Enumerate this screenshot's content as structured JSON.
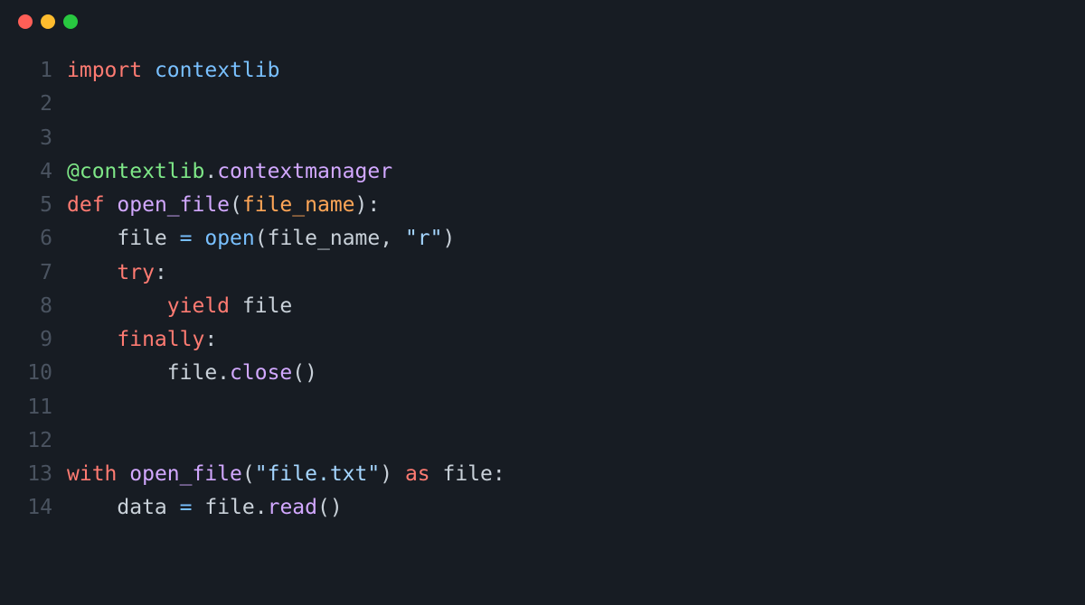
{
  "window": {
    "dots": [
      "red",
      "yellow",
      "green"
    ]
  },
  "code": {
    "lines": [
      {
        "num": "1",
        "tokens": [
          {
            "t": "import",
            "c": "kw"
          },
          {
            "t": " ",
            "c": ""
          },
          {
            "t": "contextlib",
            "c": "ident"
          }
        ]
      },
      {
        "num": "2",
        "tokens": []
      },
      {
        "num": "3",
        "tokens": []
      },
      {
        "num": "4",
        "tokens": [
          {
            "t": "@contextlib",
            "c": "dec"
          },
          {
            "t": ".",
            "c": "punct"
          },
          {
            "t": "contextmanager",
            "c": "decfn"
          }
        ]
      },
      {
        "num": "5",
        "tokens": [
          {
            "t": "def",
            "c": "kw"
          },
          {
            "t": " ",
            "c": ""
          },
          {
            "t": "open_file",
            "c": "fn"
          },
          {
            "t": "(",
            "c": "punct"
          },
          {
            "t": "file_name",
            "c": "param"
          },
          {
            "t": "):",
            "c": "punct"
          }
        ]
      },
      {
        "num": "6",
        "tokens": [
          {
            "t": "    ",
            "c": ""
          },
          {
            "t": "file",
            "c": "var"
          },
          {
            "t": " ",
            "c": ""
          },
          {
            "t": "=",
            "c": "op"
          },
          {
            "t": " ",
            "c": ""
          },
          {
            "t": "open",
            "c": "builtin"
          },
          {
            "t": "(",
            "c": "punct"
          },
          {
            "t": "file_name",
            "c": "var"
          },
          {
            "t": ", ",
            "c": "punct"
          },
          {
            "t": "\"r\"",
            "c": "str"
          },
          {
            "t": ")",
            "c": "punct"
          }
        ]
      },
      {
        "num": "7",
        "tokens": [
          {
            "t": "    ",
            "c": ""
          },
          {
            "t": "try",
            "c": "kw"
          },
          {
            "t": ":",
            "c": "punct"
          }
        ]
      },
      {
        "num": "8",
        "tokens": [
          {
            "t": "        ",
            "c": ""
          },
          {
            "t": "yield",
            "c": "kw"
          },
          {
            "t": " ",
            "c": ""
          },
          {
            "t": "file",
            "c": "var"
          }
        ]
      },
      {
        "num": "9",
        "tokens": [
          {
            "t": "    ",
            "c": ""
          },
          {
            "t": "finally",
            "c": "kw"
          },
          {
            "t": ":",
            "c": "punct"
          }
        ]
      },
      {
        "num": "10",
        "tokens": [
          {
            "t": "        ",
            "c": ""
          },
          {
            "t": "file",
            "c": "var"
          },
          {
            "t": ".",
            "c": "punct"
          },
          {
            "t": "close",
            "c": "fn"
          },
          {
            "t": "()",
            "c": "punct"
          }
        ]
      },
      {
        "num": "11",
        "tokens": []
      },
      {
        "num": "12",
        "tokens": []
      },
      {
        "num": "13",
        "tokens": [
          {
            "t": "with",
            "c": "kw"
          },
          {
            "t": " ",
            "c": ""
          },
          {
            "t": "open_file",
            "c": "fn"
          },
          {
            "t": "(",
            "c": "punct"
          },
          {
            "t": "\"file.txt\"",
            "c": "str"
          },
          {
            "t": ")",
            "c": "punct"
          },
          {
            "t": " ",
            "c": ""
          },
          {
            "t": "as",
            "c": "kw"
          },
          {
            "t": " ",
            "c": ""
          },
          {
            "t": "file",
            "c": "var"
          },
          {
            "t": ":",
            "c": "punct"
          }
        ]
      },
      {
        "num": "14",
        "tokens": [
          {
            "t": "    ",
            "c": ""
          },
          {
            "t": "data",
            "c": "var"
          },
          {
            "t": " ",
            "c": ""
          },
          {
            "t": "=",
            "c": "op"
          },
          {
            "t": " ",
            "c": ""
          },
          {
            "t": "file",
            "c": "var"
          },
          {
            "t": ".",
            "c": "punct"
          },
          {
            "t": "read",
            "c": "fn"
          },
          {
            "t": "()",
            "c": "punct"
          }
        ]
      }
    ]
  }
}
